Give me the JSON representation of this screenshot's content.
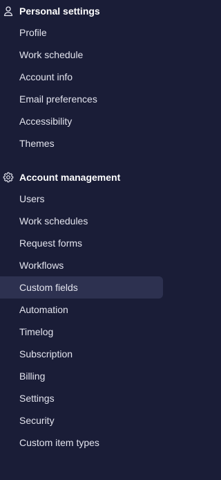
{
  "sections": [
    {
      "title": "Personal settings",
      "icon": "person-icon",
      "items": [
        "Profile",
        "Work schedule",
        "Account info",
        "Email preferences",
        "Accessibility",
        "Themes"
      ]
    },
    {
      "title": "Account management",
      "icon": "gear-icon",
      "items": [
        "Users",
        "Work schedules",
        "Request forms",
        "Workflows",
        "Custom fields",
        "Automation",
        "Timelog",
        "Subscription",
        "Billing",
        "Settings",
        "Security",
        "Custom item types"
      ]
    }
  ],
  "active_item": "Custom fields",
  "colors": {
    "background": "#1a1d37",
    "active_background": "#2d3150",
    "text": "#e3e4ee",
    "header_text": "#ffffff"
  }
}
